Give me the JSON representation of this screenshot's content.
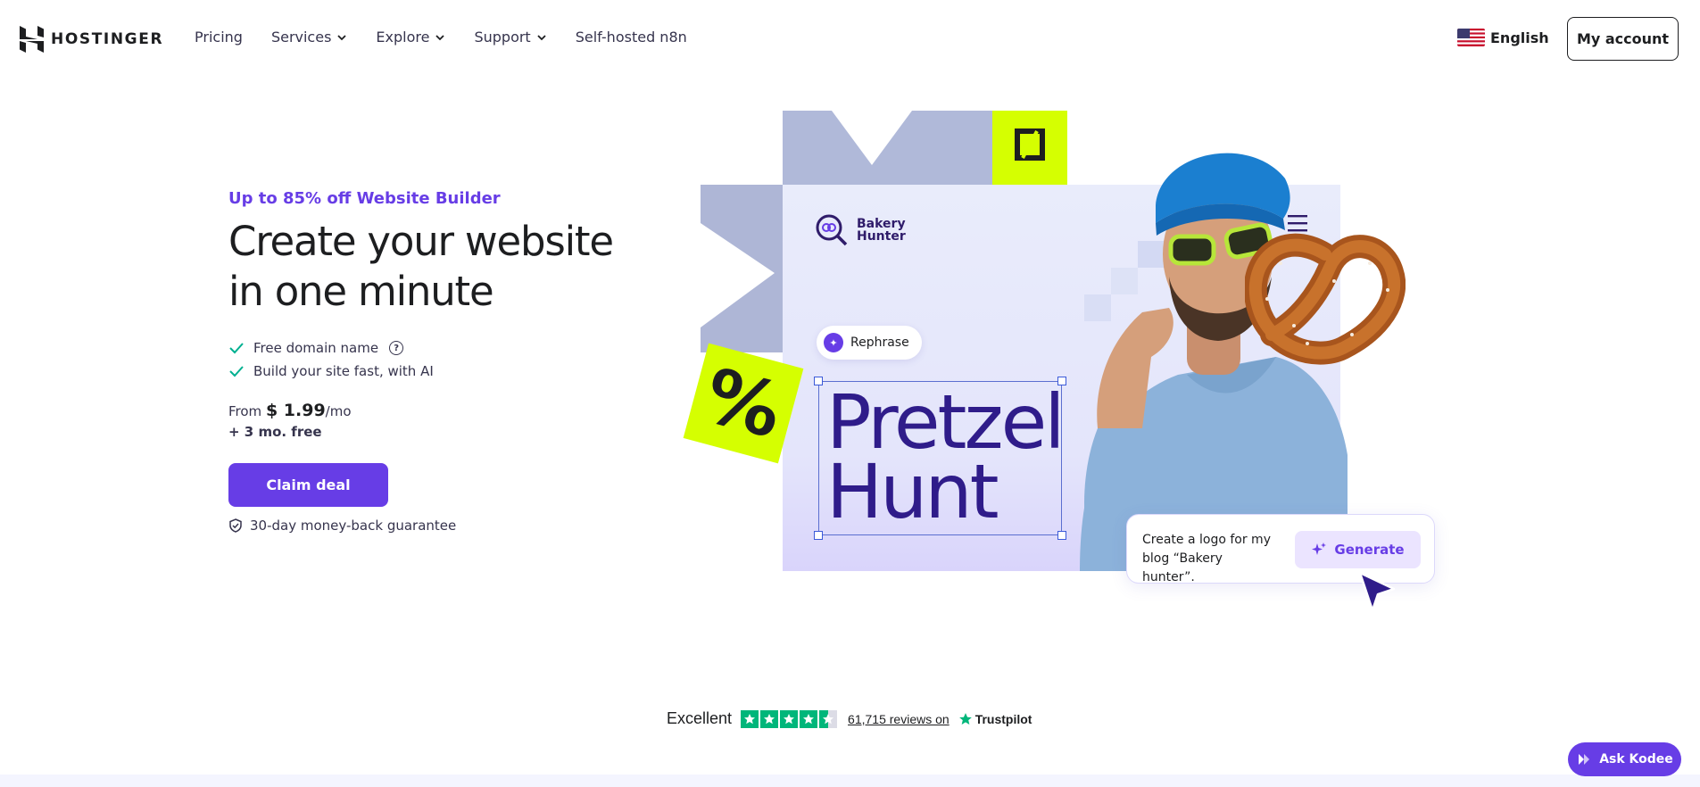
{
  "brand": {
    "name": "HOSTINGER"
  },
  "nav": {
    "links": [
      {
        "label": "Pricing"
      },
      {
        "label": "Services"
      },
      {
        "label": "Explore"
      },
      {
        "label": "Support"
      },
      {
        "label": "Self-hosted n8n"
      }
    ],
    "language": "English",
    "account_button": "My account"
  },
  "hero": {
    "promo": "Up to 85% off Website Builder",
    "headline": "Create your website in one minute",
    "features": [
      "Free domain name",
      "Build your site fast, with AI"
    ],
    "price_prefix": "From",
    "price_amount": "$ 1.99",
    "price_suffix": "/mo",
    "bonus": "+ 3 mo. free",
    "cta": "Claim deal",
    "guarantee": "30-day money-back guarantee"
  },
  "illustration": {
    "site_name_line1": "Bakery",
    "site_name_line2": "Hunter",
    "rephrase_label": "Rephrase",
    "title_line1": "Pretzel",
    "title_line2": "Hunt",
    "percent_symbol": "%",
    "prompt_text": "Create a logo for my blog “Bakery hunter”.",
    "generate_label": "Generate"
  },
  "trust": {
    "rating_label": "Excellent",
    "reviews_text": "61,715 reviews on",
    "brand": "Trustpilot",
    "stars": 4.5
  },
  "assistant": {
    "label": "Ask Kodee"
  },
  "colors": {
    "accent": "#673de6",
    "lime": "#d5ff01",
    "trust_green": "#00b67a",
    "dark": "#1d1e20"
  }
}
